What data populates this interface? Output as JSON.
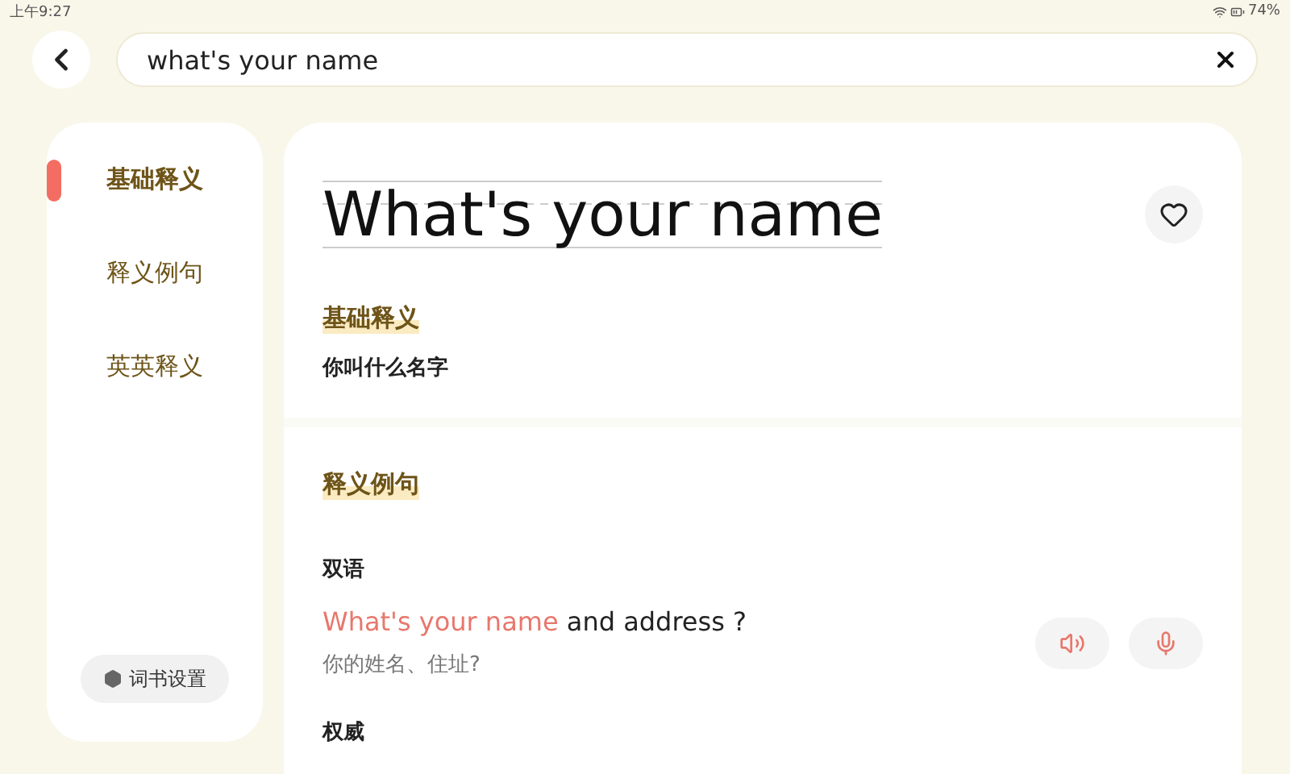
{
  "status_bar": {
    "time": "上午9:27",
    "battery": "74%"
  },
  "search": {
    "value": "what's your name"
  },
  "sidebar": {
    "items": [
      {
        "label": "基础释义",
        "selected": true
      },
      {
        "label": "释义例句",
        "selected": false
      },
      {
        "label": "英英释义",
        "selected": false
      }
    ],
    "settings_button": "词书设置"
  },
  "entry": {
    "headword": "What's your name",
    "favorite": false
  },
  "basic": {
    "heading": "基础释义",
    "meaning": "你叫什么名字"
  },
  "examples": {
    "heading": "释义例句",
    "group": "双语",
    "sentence": {
      "highlight": "What's your name",
      "rest": " and address ?",
      "translation": "你的姓名、住址?"
    },
    "next_group": "权威"
  }
}
